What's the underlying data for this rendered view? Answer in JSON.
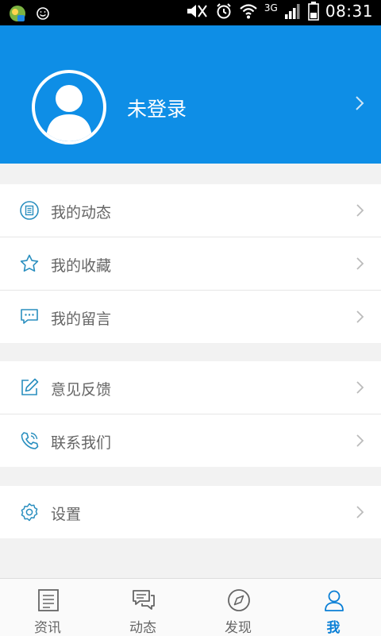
{
  "status_bar": {
    "time": "08:31",
    "network": "3G"
  },
  "profile": {
    "name": "未登录"
  },
  "menu_groups": [
    {
      "items": [
        {
          "label": "我的动态",
          "icon": "news-feed-icon"
        },
        {
          "label": "我的收藏",
          "icon": "star-icon"
        },
        {
          "label": "我的留言",
          "icon": "comment-icon"
        }
      ]
    },
    {
      "items": [
        {
          "label": "意见反馈",
          "icon": "edit-icon"
        },
        {
          "label": "联系我们",
          "icon": "phone-icon"
        }
      ]
    },
    {
      "items": [
        {
          "label": "设置",
          "icon": "gear-icon"
        }
      ]
    }
  ],
  "tabs": [
    {
      "label": "资讯",
      "icon": "news-icon",
      "active": false
    },
    {
      "label": "动态",
      "icon": "chat-icon",
      "active": false
    },
    {
      "label": "发现",
      "icon": "compass-icon",
      "active": false
    },
    {
      "label": "我",
      "icon": "user-icon",
      "active": true
    }
  ],
  "colors": {
    "primary": "#0e8ee6",
    "active_tab": "#0a7fd6",
    "icon": "#2a8fbf"
  }
}
